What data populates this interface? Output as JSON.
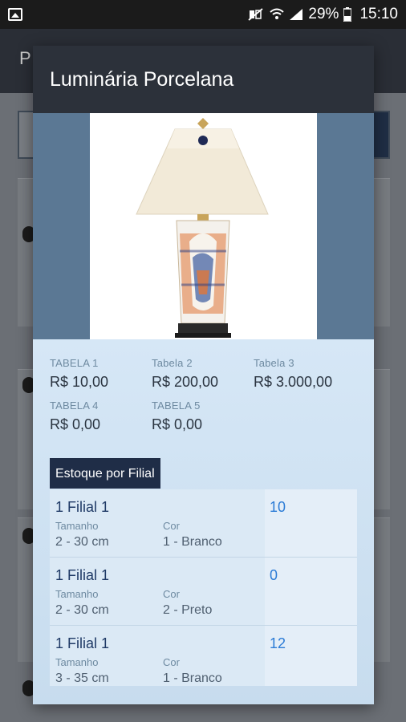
{
  "status_bar": {
    "battery": "29%",
    "time": "15:10",
    "icons": [
      "image-icon",
      "mute-icon",
      "wifi-icon",
      "signal-icon",
      "battery-icon"
    ]
  },
  "background_app": {
    "title_initial": "P"
  },
  "modal": {
    "title": "Luminária Porcelana",
    "prices": [
      {
        "label": "TABELA 1",
        "value": "R$ 10,00"
      },
      {
        "label": "Tabela 2",
        "value": "R$ 200,00"
      },
      {
        "label": "Tabela 3",
        "value": "R$ 3.000,00"
      },
      {
        "label": "TABELA 4",
        "value": "R$ 0,00"
      },
      {
        "label": "TABELA 5",
        "value": "R$ 0,00"
      }
    ],
    "stock_title": "Estoque por Filial",
    "stock": [
      {
        "filial": "1 Filial 1",
        "qty": "10",
        "size_label": "Tamanho",
        "size": "2 - 30 cm",
        "color_label": "Cor",
        "color": "1 - Branco"
      },
      {
        "filial": "1 Filial 1",
        "qty": "0",
        "size_label": "Tamanho",
        "size": "2 - 30 cm",
        "color_label": "Cor",
        "color": "2 - Preto"
      },
      {
        "filial": "1 Filial 1",
        "qty": "12",
        "size_label": "Tamanho",
        "size": "3 - 35 cm",
        "color_label": "Cor",
        "color": "1 - Branco"
      }
    ]
  }
}
